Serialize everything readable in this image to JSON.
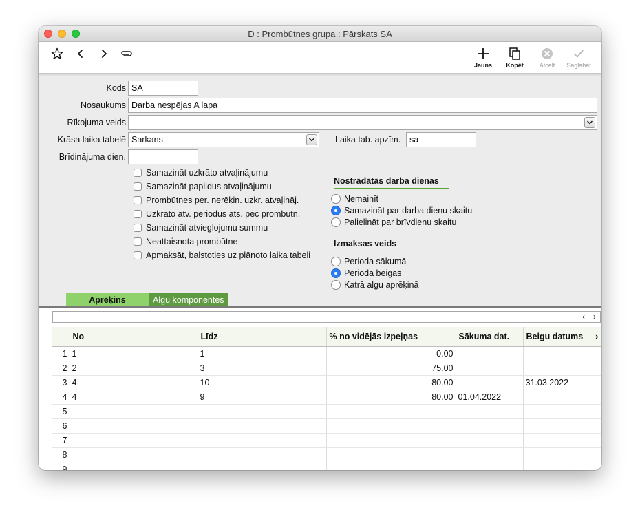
{
  "window": {
    "title": "D : Prombūtnes grupa : Pārskats SA"
  },
  "toolbar": {
    "left_icons": [
      "star-icon",
      "chevron-left-icon",
      "chevron-right-icon",
      "paperclip-icon"
    ],
    "buttons": [
      {
        "label": "Jauns",
        "icon": "plus-icon",
        "enabled": true
      },
      {
        "label": "Kopēt",
        "icon": "copy-icon",
        "enabled": true
      },
      {
        "label": "Atcelt",
        "icon": "cancel-icon",
        "enabled": false
      },
      {
        "label": "Saglabāt",
        "icon": "checkmark-icon",
        "enabled": false
      }
    ]
  },
  "form": {
    "kods_label": "Kods",
    "kods_value": "SA",
    "nosaukums_label": "Nosaukums",
    "nosaukums_value": "Darba nespējas A lapa",
    "rikojuma_label": "Rīkojuma veids",
    "rikojuma_value": "",
    "krasa_label": "Krāsa laika tabelē",
    "krasa_value": "Sarkans",
    "laika_apzim_label": "Laika tab. apzīm.",
    "laika_apzim_value": "sa",
    "bridinajuma_label": "Brīdinājuma dien.",
    "bridinajuma_value": ""
  },
  "checkboxes": [
    {
      "label": "Samazināt uzkrāto atvaļinājumu",
      "checked": false
    },
    {
      "label": "Samazināt papildus atvaļinājumu",
      "checked": false
    },
    {
      "label": "Prombūtnes per. nerēķin. uzkr. atvaļināj.",
      "checked": false
    },
    {
      "label": "Uzkrāto atv. periodus ats. pēc prombūtn.",
      "checked": false
    },
    {
      "label": "Samazināt atvieglojumu summu",
      "checked": false
    },
    {
      "label": "Neattaisnota prombūtne",
      "checked": false
    },
    {
      "label": "Apmaksāt, balstoties uz plānoto laika tabeli",
      "checked": false
    }
  ],
  "worked_days": {
    "title": "Nostrādātās darba dienas",
    "options": [
      {
        "label": "Nemainīt",
        "selected": false
      },
      {
        "label": "Samazināt par darba dienu skaitu",
        "selected": true
      },
      {
        "label": "Palielināt par brīvdienu skaitu",
        "selected": false
      }
    ]
  },
  "payment": {
    "title": "Izmaksas veids",
    "options": [
      {
        "label": "Perioda sākumā",
        "selected": false
      },
      {
        "label": "Perioda beigās",
        "selected": true
      },
      {
        "label": "Katrā algu aprēķinā",
        "selected": false
      }
    ]
  },
  "tabs": [
    {
      "label": "Aprēķins",
      "active": true
    },
    {
      "label": "Algu komponentes",
      "active": false
    }
  ],
  "grid": {
    "columns": [
      "No",
      "Līdz",
      "% no vidējās izpeļņas",
      "Sākuma dat.",
      "Beigu datums"
    ],
    "rows": [
      {
        "n": "1",
        "no": "1",
        "lidz": "1",
        "pct": "0.00",
        "start": "",
        "end": ""
      },
      {
        "n": "2",
        "no": "2",
        "lidz": "3",
        "pct": "75.00",
        "start": "",
        "end": ""
      },
      {
        "n": "3",
        "no": "4",
        "lidz": "10",
        "pct": "80.00",
        "start": "",
        "end": "31.03.2022"
      },
      {
        "n": "4",
        "no": "4",
        "lidz": "9",
        "pct": "80.00",
        "start": "01.04.2022",
        "end": ""
      },
      {
        "n": "5",
        "no": "",
        "lidz": "",
        "pct": "",
        "start": "",
        "end": ""
      },
      {
        "n": "6",
        "no": "",
        "lidz": "",
        "pct": "",
        "start": "",
        "end": ""
      },
      {
        "n": "7",
        "no": "",
        "lidz": "",
        "pct": "",
        "start": "",
        "end": ""
      },
      {
        "n": "8",
        "no": "",
        "lidz": "",
        "pct": "",
        "start": "",
        "end": ""
      },
      {
        "n": "9",
        "no": "",
        "lidz": "",
        "pct": "",
        "start": "",
        "end": ""
      }
    ]
  },
  "colors": {
    "accent_green": "#8fd16a",
    "tab_dark_green": "#5e9a3f",
    "radio_blue": "#2a7df5"
  }
}
